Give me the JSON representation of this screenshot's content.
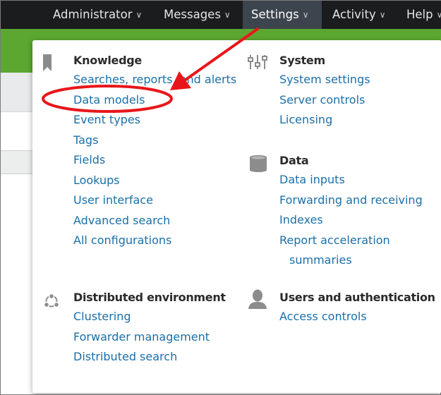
{
  "topnav": {
    "items": [
      {
        "label": "Administrator"
      },
      {
        "label": "Messages"
      },
      {
        "label": "Settings"
      },
      {
        "label": "Activity"
      },
      {
        "label": "Help"
      }
    ]
  },
  "dropdown": {
    "knowledge": {
      "title": "Knowledge",
      "icon": "bookmark-icon",
      "links": [
        "Searches, reports, and alerts",
        "Data models",
        "Event types",
        "Tags",
        "Fields",
        "Lookups",
        "User interface",
        "Advanced search",
        "All configurations"
      ]
    },
    "system": {
      "title": "System",
      "icon": "sliders-icon",
      "links": [
        "System settings",
        "Server controls",
        "Licensing"
      ]
    },
    "data": {
      "title": "Data",
      "icon": "database-icon",
      "links": [
        "Data inputs",
        "Forwarding and receiving",
        "Indexes",
        "Report acceleration",
        "summaries"
      ]
    },
    "distributed": {
      "title": "Distributed environment",
      "icon": "network-icon",
      "links": [
        "Clustering",
        "Forwarder management",
        "Distributed search"
      ]
    },
    "users": {
      "title": "Users and authentication",
      "icon": "user-icon",
      "links": [
        "Access controls"
      ]
    }
  },
  "colors": {
    "topbar": "#1a1c1e",
    "active_tab": "#3c444d",
    "greenbar": "#5ca731",
    "link": "#1a6fa8",
    "annotation": "#e8161b"
  }
}
